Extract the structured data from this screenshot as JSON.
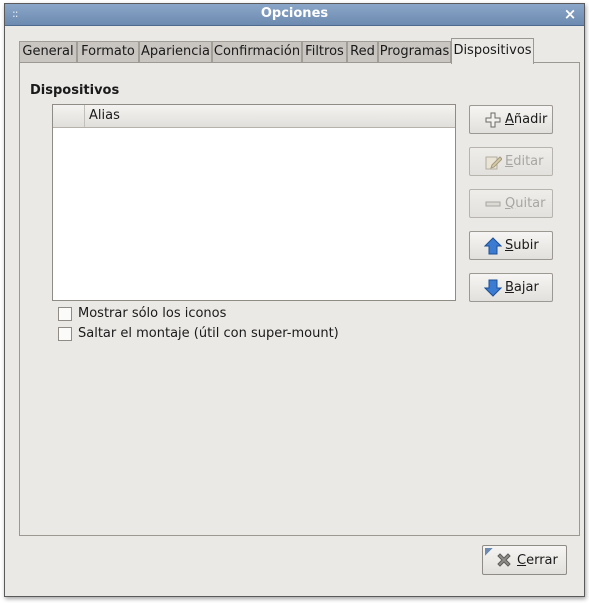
{
  "window": {
    "title": "Opciones",
    "grip": "::",
    "close_symbol": "×"
  },
  "tabs": [
    {
      "label": "General"
    },
    {
      "label": "Formato"
    },
    {
      "label": "Apariencia"
    },
    {
      "label": "Confirmación"
    },
    {
      "label": "Filtros"
    },
    {
      "label": "Red"
    },
    {
      "label": "Programas"
    },
    {
      "label": "Dispositivos",
      "active": true
    }
  ],
  "devices": {
    "section_title": "Dispositivos",
    "column_header": "Alias",
    "buttons": {
      "add": {
        "accel": "A",
        "rest": "ñadir",
        "icon": "plus-icon",
        "enabled": true
      },
      "edit": {
        "accel": "E",
        "rest": "ditar",
        "icon": "edit-icon",
        "enabled": false
      },
      "remove": {
        "accel": "Q",
        "rest": "uitar",
        "icon": "minus-icon",
        "enabled": false
      },
      "up": {
        "accel": "S",
        "rest": "ubir",
        "icon": "arrow-up-icon",
        "enabled": true
      },
      "down": {
        "accel": "B",
        "rest": "ajar",
        "icon": "arrow-down-icon",
        "enabled": true
      }
    },
    "options": {
      "show_icons_only": {
        "label": "Mostrar sólo los iconos",
        "checked": false
      },
      "skip_mount": {
        "label": "Saltar el montaje (útil con super-mount)",
        "checked": false
      }
    }
  },
  "footer": {
    "close": {
      "accel": "C",
      "rest": "errar",
      "icon": "close-x-icon"
    }
  },
  "colors": {
    "titlebar": "#7a97bd",
    "window_bg": "#ebe9e5",
    "arrow_blue": "#2f6fc4"
  }
}
